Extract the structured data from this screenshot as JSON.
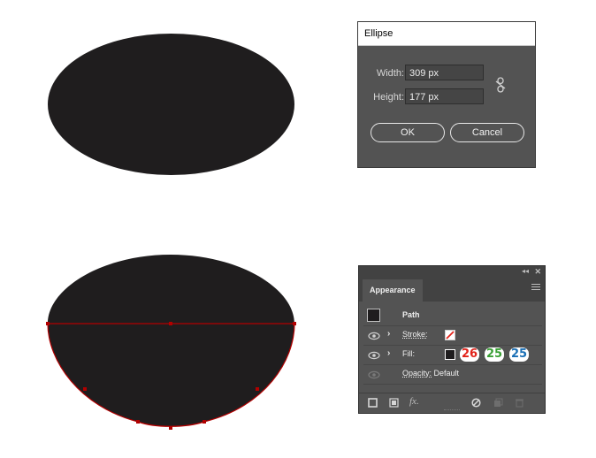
{
  "ellipse_dialog": {
    "title": "Ellipse",
    "width_label": "Width:",
    "width_value": "309 px",
    "height_label": "Height:",
    "height_value": "177 px",
    "ok_label": "OK",
    "cancel_label": "Cancel",
    "link_icon": "unlink-chain-icon"
  },
  "appearance_panel": {
    "tab_label": "Appearance",
    "collapse_icon": "double-chevron-icon",
    "close_icon": "close-icon",
    "menu_icon": "hamburger-menu-icon",
    "object_label": "Path",
    "rows": {
      "stroke": {
        "label": "Stroke:",
        "swatch": "none-swatch"
      },
      "fill": {
        "label": "Fill:",
        "swatch_color": "#1f1d1e",
        "rgb": [
          {
            "value": "26",
            "color": "#e2231a"
          },
          {
            "value": "25",
            "color": "#3aa035"
          },
          {
            "value": "25",
            "color": "#1a6fb5"
          }
        ]
      },
      "opacity": {
        "label": "Opacity:",
        "value": "Default"
      }
    },
    "footer_icons": [
      "add-stroke-icon",
      "add-fill-icon",
      "fx-icon",
      "clear-appearance-icon",
      "duplicate-item-icon",
      "delete-item-icon"
    ],
    "fx_label": "fx."
  },
  "colors": {
    "shape_fill": "#1f1d1e",
    "selection": "#b20000",
    "panel_bg": "#535353"
  }
}
